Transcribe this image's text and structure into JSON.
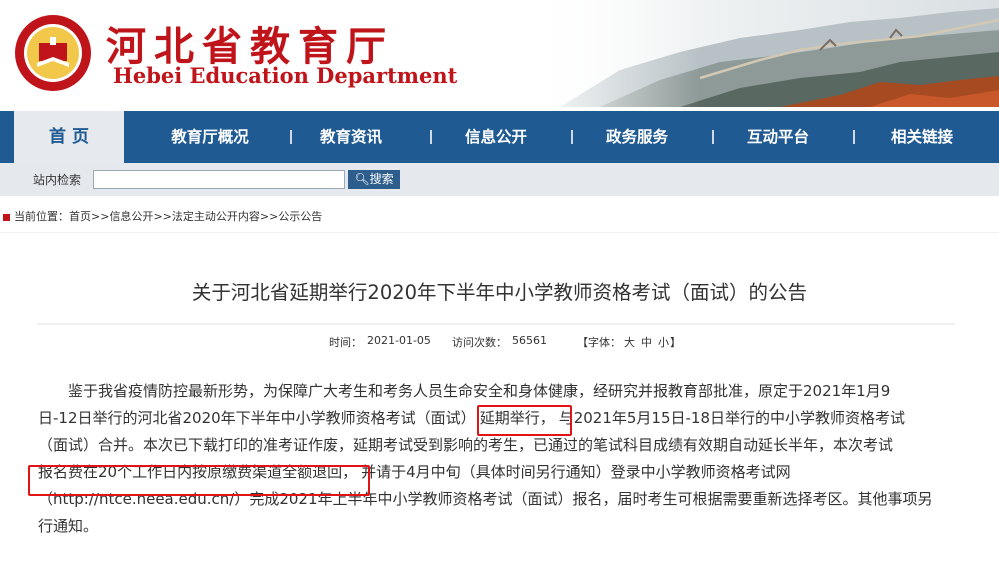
{
  "header": {
    "title_cn": "河北省教育厅",
    "title_en": "Hebei Education Department",
    "brand_color": "#c0141b",
    "logo_text": "河北省教育厅 Hebei Education Department"
  },
  "nav": {
    "items": [
      {
        "label": "首 页",
        "active": true
      },
      {
        "label": "教育厅概况"
      },
      {
        "label": "教育资讯"
      },
      {
        "label": "信息公开"
      },
      {
        "label": "政务服务"
      },
      {
        "label": "互动平台"
      },
      {
        "label": "相关链接"
      }
    ],
    "background": "#1f5a93"
  },
  "search": {
    "label": "站内检索",
    "value": "",
    "button_label": "搜索"
  },
  "breadcrumb": {
    "prefix": "当前位置：",
    "items": [
      "首页",
      "信息公开",
      "法定主动公开内容",
      "公示公告"
    ],
    "separator": ">>"
  },
  "article": {
    "title": "关于河北省延期举行2020年下半年中小学教师资格考试（面试）的公告",
    "meta": {
      "time_label": "时间：",
      "time": "2021-01-05",
      "visits_label": "访问次数：",
      "visits": "56561",
      "font_label": "【字体：",
      "font_large": "大",
      "font_medium": "中",
      "font_small": "小",
      "font_close": "】"
    },
    "lines": [
      "鉴于我省疫情防控最新形势，为保障广大考生和考务人员生命安全和身体健康，经研究并报教育部批准，原定于2021年1月9",
      "日-12日举行的河北省2020年下半年中小学教师资格考试（面试）",
      "延期举行，",
      "与2021年5月15日-18日举行的中小学教师资格考试",
      "（面试）合并。本次已下载打印的准考证作废，延期考试受到影响的考生，已通过的笔试科目成绩有效期自动延长半年，本次考试",
      "报名费在20个工作日内按原缴费渠道全额退回，",
      "并请于4月中旬（具体时间另行通知）登录中小学教师资格考试网",
      "（http://ntce.neea.edu.cn/）完成2021年上半年中小学教师资格考试（面试）报名，届时考生可根据需要重新选择考区。其他事项另",
      "行通知。"
    ],
    "highlight_color": "#e01414"
  }
}
